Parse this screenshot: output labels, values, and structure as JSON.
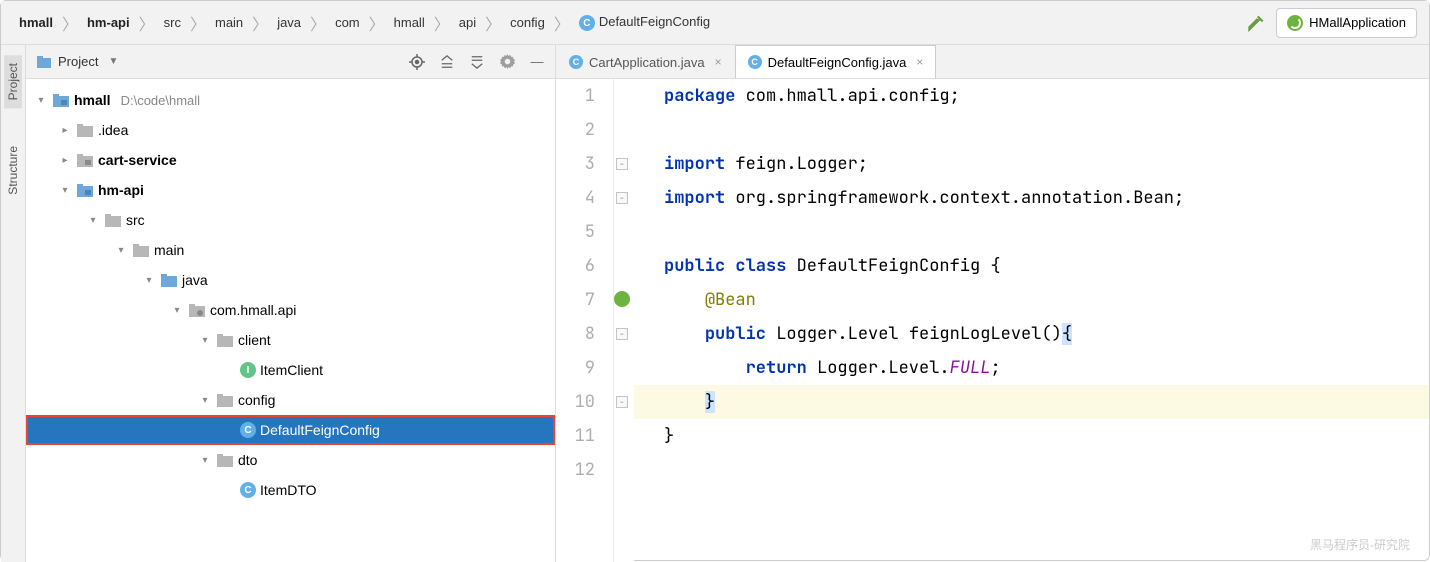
{
  "breadcrumb": {
    "items": [
      "hmall",
      "hm-api",
      "src",
      "main",
      "java",
      "com",
      "hmall",
      "api",
      "config"
    ],
    "file": "DefaultFeignConfig",
    "file_icon": "C"
  },
  "run_config": "HMallApplication",
  "side_tabs": {
    "project": "Project",
    "structure": "Structure"
  },
  "panel": {
    "title": "Project"
  },
  "tree": {
    "root": {
      "name": "hmall",
      "path": "D:\\code\\hmall"
    },
    "idea": ".idea",
    "cart_service": "cart-service",
    "hm_api": "hm-api",
    "src": "src",
    "main": "main",
    "java": "java",
    "pkg": "com.hmall.api",
    "client": "client",
    "item_client": "ItemClient",
    "config": "config",
    "default_feign": "DefaultFeignConfig",
    "dto": "dto",
    "item_dto": "ItemDTO"
  },
  "tabs": {
    "t1": "CartApplication.java",
    "t2": "DefaultFeignConfig.java"
  },
  "code": {
    "l1_kw": "package",
    "l1_rest": " com.hmall.api.config;",
    "l3_kw": "import",
    "l3_rest": " feign.Logger;",
    "l4_kw": "import",
    "l4_rest_a": " org.springframework.context.annotation.",
    "l4_rest_b": "Bean",
    "l4_rest_c": ";",
    "l6_a": "public class",
    "l6_b": " DefaultFeignConfig {",
    "l7_ann": "@Bean",
    "l8_a": "public",
    "l8_b": " Logger.Level feignLogLevel()",
    "l8_c": "{",
    "l9_a": "return",
    "l9_b": " Logger.Level.",
    "l9_c": "FULL",
    "l9_d": ";",
    "l10": "}",
    "l11": "}"
  },
  "line_numbers": [
    "1",
    "2",
    "3",
    "4",
    "5",
    "6",
    "7",
    "8",
    "9",
    "10",
    "11",
    "12"
  ],
  "watermark": "黑马程序员-研究院"
}
